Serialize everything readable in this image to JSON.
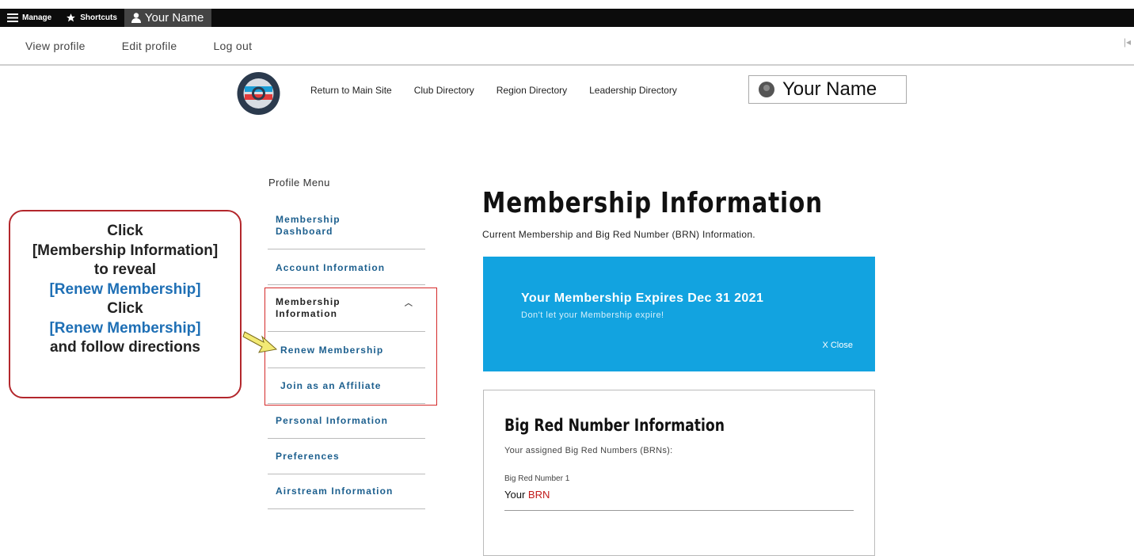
{
  "toolbar": {
    "manage": "Manage",
    "shortcuts": "Shortcuts",
    "user": "Your Name"
  },
  "tray": {
    "view_profile": "View profile",
    "edit_profile": "Edit profile",
    "log_out": "Log out"
  },
  "nav": {
    "main_site": "Return to Main Site",
    "club_dir": "Club Directory",
    "region_dir": "Region Directory",
    "leadership_dir": "Leadership Directory"
  },
  "userbox": {
    "name": "Your Name"
  },
  "profile_menu": {
    "title": "Profile Menu",
    "dashboard_1": "Membership",
    "dashboard_2": "Dashboard",
    "account": "Account Information",
    "membership_1": "Membership",
    "membership_2": "Information",
    "renew": "Renew Membership",
    "affiliate": "Join as an Affiliate",
    "personal": "Personal Information",
    "preferences": "Preferences",
    "airstream": "Airstream Information"
  },
  "callout": {
    "l1": "Click",
    "l2": "[Membership Information]",
    "l3": "to reveal",
    "l4": "[Renew Membership]",
    "l5": "Click",
    "l6": "[Renew Membership]",
    "l7": "and follow directions"
  },
  "main": {
    "title": "Membership Information",
    "subtitle": "Current Membership and Big Red Number (BRN) Information.",
    "alert_title": "Your Membership Expires Dec 31 2021",
    "alert_sub": "Don't let your Membership expire!",
    "alert_close": "X Close",
    "brn_title": "Big Red Number Information",
    "brn_text": "Your assigned Big Red Numbers (BRNs):",
    "brn_label": "Big Red Number 1",
    "brn_value_1": "Your",
    "brn_value_2": "BRN"
  },
  "colors": {
    "accent": "#12a3e0",
    "link": "#1c5f8e",
    "callout_border": "#b3272c",
    "highlight": "#d42a2a"
  }
}
